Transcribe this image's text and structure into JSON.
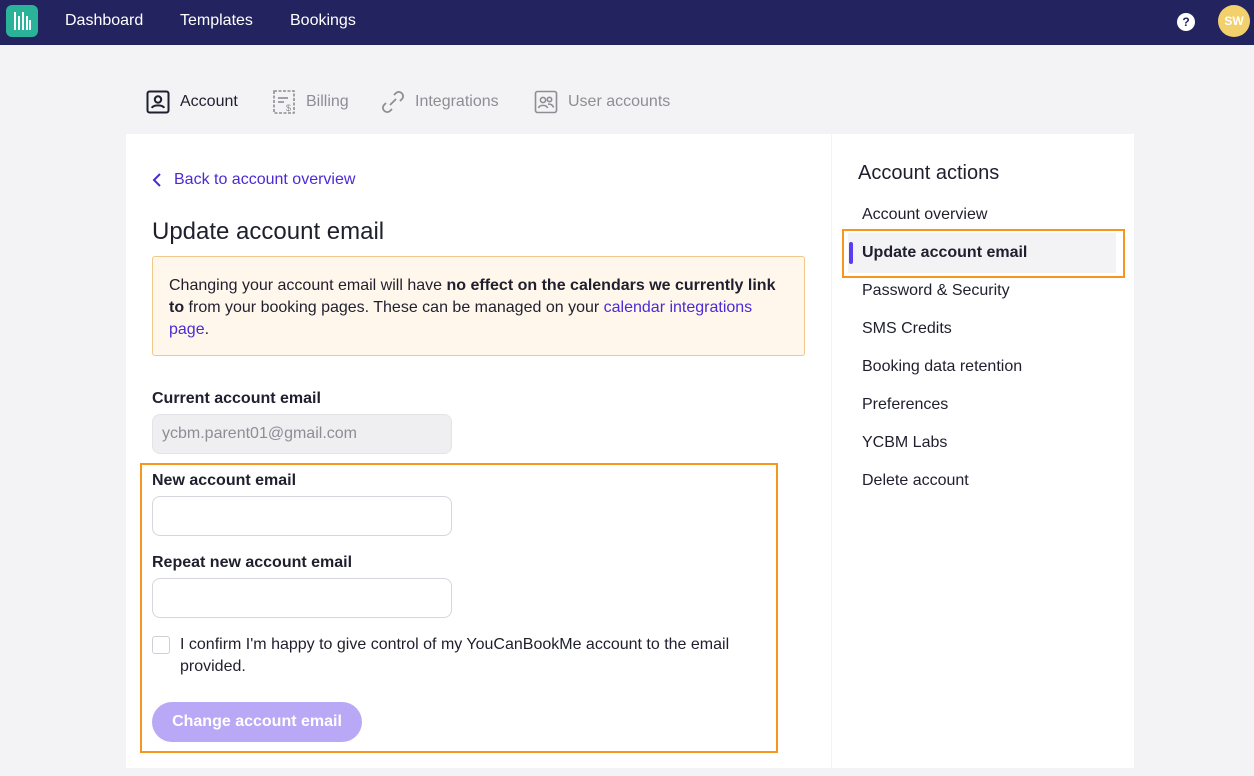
{
  "topbar": {
    "logo_icon": "ycbm-logo-icon",
    "nav": [
      "Dashboard",
      "Templates",
      "Bookings"
    ],
    "help_label": "?",
    "avatar_initials": "SW"
  },
  "tabs": [
    {
      "label": "Account",
      "icon": "account-icon",
      "active": true
    },
    {
      "label": "Billing",
      "icon": "billing-icon",
      "active": false
    },
    {
      "label": "Integrations",
      "icon": "integrations-icon",
      "active": false
    },
    {
      "label": "User accounts",
      "icon": "user-accounts-icon",
      "active": false
    }
  ],
  "main": {
    "back_link": "Back to account overview",
    "title": "Update account email",
    "notice": {
      "text_1": "Changing your account email will have ",
      "bold": "no effect on the calendars we currently link to",
      "text_2": " from your booking pages. These can be managed on your ",
      "link": "calendar integrations page",
      "text_3": "."
    },
    "current_email": {
      "label": "Current account email",
      "value": "ycbm.parent01@gmail.com"
    },
    "new_email": {
      "label": "New account email",
      "value": ""
    },
    "repeat_email": {
      "label": "Repeat new account email",
      "value": ""
    },
    "confirm_text": "I confirm I'm happy to give control of my YouCanBookMe account to the email provided.",
    "submit_label": "Change account email"
  },
  "side": {
    "title": "Account actions",
    "items": [
      "Account overview",
      "Update account email",
      "Password & Security",
      "SMS Credits",
      "Booking data retention",
      "Preferences",
      "YCBM Labs",
      "Delete account"
    ],
    "active_index": 1
  },
  "colors": {
    "topbar": "#22235f",
    "accent": "#4b2bd6",
    "highlight": "#f7961d",
    "button_disabled": "#b9a8f5"
  }
}
